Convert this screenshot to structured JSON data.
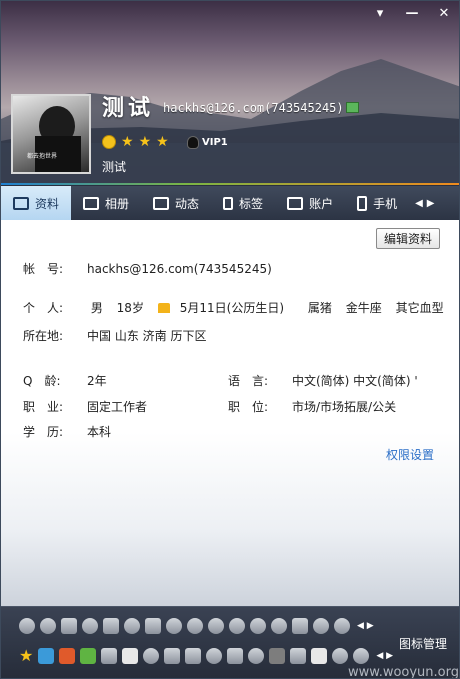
{
  "window": {
    "controls": [
      "pin",
      "minimize",
      "close"
    ]
  },
  "profile": {
    "nickname": "测试",
    "email_qq": "hackhs@126.com(743545245)",
    "vip": "VIP1",
    "signature": "测试",
    "avatar_caption": "都去抱世界"
  },
  "tabs": [
    {
      "label": "资料",
      "icon": "profile-card-icon",
      "active": true
    },
    {
      "label": "相册",
      "icon": "photo-album-icon"
    },
    {
      "label": "动态",
      "icon": "feed-list-icon"
    },
    {
      "label": "标签",
      "icon": "bookmark-icon"
    },
    {
      "label": "账户",
      "icon": "wallet-icon"
    },
    {
      "label": "手机",
      "icon": "mobile-phone-icon"
    }
  ],
  "edit_button": "编辑资料",
  "details": {
    "account": {
      "label": "帐　号:",
      "value": "hackhs@126.com(743545245)"
    },
    "personal": {
      "label": "个　人:",
      "gender": "男",
      "age": "18岁",
      "birthday": "5月11日(公历生日)",
      "zodiac_animal": "属猪",
      "constellation": "金牛座",
      "blood_type": "其它血型"
    },
    "location": {
      "label": "所在地:",
      "value": "中国 山东 济南 历下区"
    },
    "q_age": {
      "label": "Q　龄:",
      "value": "2年"
    },
    "language": {
      "label": "语　言:",
      "value": "中文(简体) 中文(简体) '"
    },
    "occupation": {
      "label": "职　业:",
      "value": "固定工作者"
    },
    "position": {
      "label": "职　位:",
      "value": "市场/市场拓展/公关"
    },
    "education": {
      "label": "学　历:",
      "value": "本科"
    }
  },
  "permission_link": "权限设置",
  "icon_manage": "图标管理",
  "watermark": "www.wooyun.org",
  "colors": {
    "accent_tab": "#b5d6f1",
    "link": "#2a6ec7",
    "star": "#f6c21a"
  }
}
